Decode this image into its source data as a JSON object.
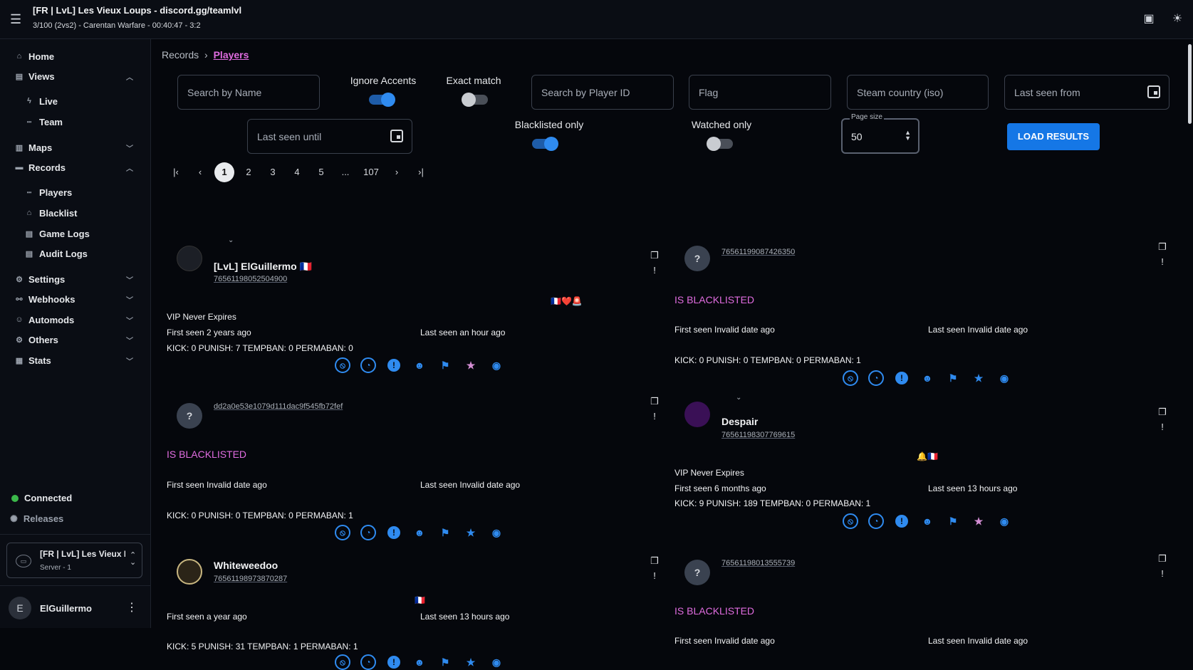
{
  "header": {
    "server_title": "[FR | LvL] Les Vieux Loups - discord.gg/teamlvl",
    "server_status": "3/100 (2vs2) - Carentan Warfare - 00:40:47 - 3:2"
  },
  "sidebar": {
    "items": [
      {
        "label": "Home",
        "icon": "home-icon"
      },
      {
        "label": "Views",
        "icon": "views-icon"
      },
      {
        "label": "Live",
        "icon": "live-icon"
      },
      {
        "label": "Team",
        "icon": "team-icon"
      },
      {
        "label": "Maps",
        "icon": "map-icon"
      },
      {
        "label": "Records",
        "icon": "folder-icon"
      },
      {
        "label": "Players",
        "icon": "players-icon"
      },
      {
        "label": "Blacklist",
        "icon": "bank-icon"
      },
      {
        "label": "Game Logs",
        "icon": "log-icon"
      },
      {
        "label": "Audit Logs",
        "icon": "log-icon"
      },
      {
        "label": "Settings",
        "icon": "gear-icon"
      },
      {
        "label": "Webhooks",
        "icon": "webhook-icon"
      },
      {
        "label": "Automods",
        "icon": "robot-icon"
      },
      {
        "label": "Others",
        "icon": "cogs-icon"
      },
      {
        "label": "Stats",
        "icon": "chart-icon"
      }
    ],
    "status": "Connected",
    "releases": "Releases",
    "server_name": "[FR | LvL] Les Vieux L",
    "server_sub": "Server - 1",
    "user_initial": "E",
    "user_name": "ElGuillermo"
  },
  "breadcrumb": {
    "parent": "Records",
    "current": "Players"
  },
  "filters": {
    "search_name": "Search by Name",
    "ignore_accents": "Ignore Accents",
    "exact_match": "Exact match",
    "search_id": "Search by Player ID",
    "flag": "Flag",
    "steam_country": "Steam country (iso)",
    "last_seen_from": "Last seen from",
    "last_seen_until": "Last seen until",
    "blacklisted_only": "Blacklisted only",
    "watched_only": "Watched only",
    "page_size_label": "Page size",
    "page_size": "50",
    "load_results": "LOAD RESULTS"
  },
  "pagination": [
    "1",
    "2",
    "3",
    "4",
    "5",
    "...",
    "107"
  ],
  "cards": [
    {
      "name": "[LvL] ElGuillermo 🇫🇷",
      "id": "76561198052504900",
      "flags": "🇫🇷❤️🚨",
      "vip": "VIP Never Expires",
      "first_seen": "First seen 2 years ago",
      "last_seen": "Last seen an hour ago",
      "stats": "KICK: 0 PUNISH: 7 TEMPBAN: 0 PERMABAN: 0"
    },
    {
      "name": "",
      "id": "76561199087426350",
      "blacklisted": "IS BLACKLISTED",
      "first_seen": "First seen Invalid date ago",
      "last_seen": "Last seen Invalid date ago",
      "stats": "KICK: 0 PUNISH: 0 TEMPBAN: 0 PERMABAN: 1"
    },
    {
      "name": "",
      "id": "dd2a0e53e1079d111dac9f545fb72fef",
      "blacklisted": "IS BLACKLISTED",
      "first_seen": "First seen Invalid date ago",
      "last_seen": "Last seen Invalid date ago",
      "stats": "KICK: 0 PUNISH: 0 TEMPBAN: 0 PERMABAN: 1"
    },
    {
      "name": "Despair",
      "id": "76561198307769615",
      "flags": "🔔🇫🇷",
      "vip": "VIP Never Expires",
      "first_seen": "First seen 6 months ago",
      "last_seen": "Last seen 13 hours ago",
      "stats": "KICK: 9 PUNISH: 189 TEMPBAN: 0 PERMABAN: 1"
    },
    {
      "name": "Whiteweedoo",
      "id": "76561198973870287",
      "flags": "🇫🇷",
      "first_seen": "First seen a year ago",
      "last_seen": "Last seen 13 hours ago",
      "stats": "KICK: 5 PUNISH: 31 TEMPBAN: 1 PERMABAN: 1"
    },
    {
      "name": "",
      "id": "76561198013555739",
      "blacklisted": "IS BLACKLISTED",
      "first_seen": "First seen Invalid date ago",
      "last_seen": "Last seen Invalid date ago"
    }
  ],
  "unknown_avatar": "?",
  "colors": {
    "accent": "#2f8bf0",
    "blacklisted": "#e06ce0",
    "connected": "#3bb84a"
  }
}
